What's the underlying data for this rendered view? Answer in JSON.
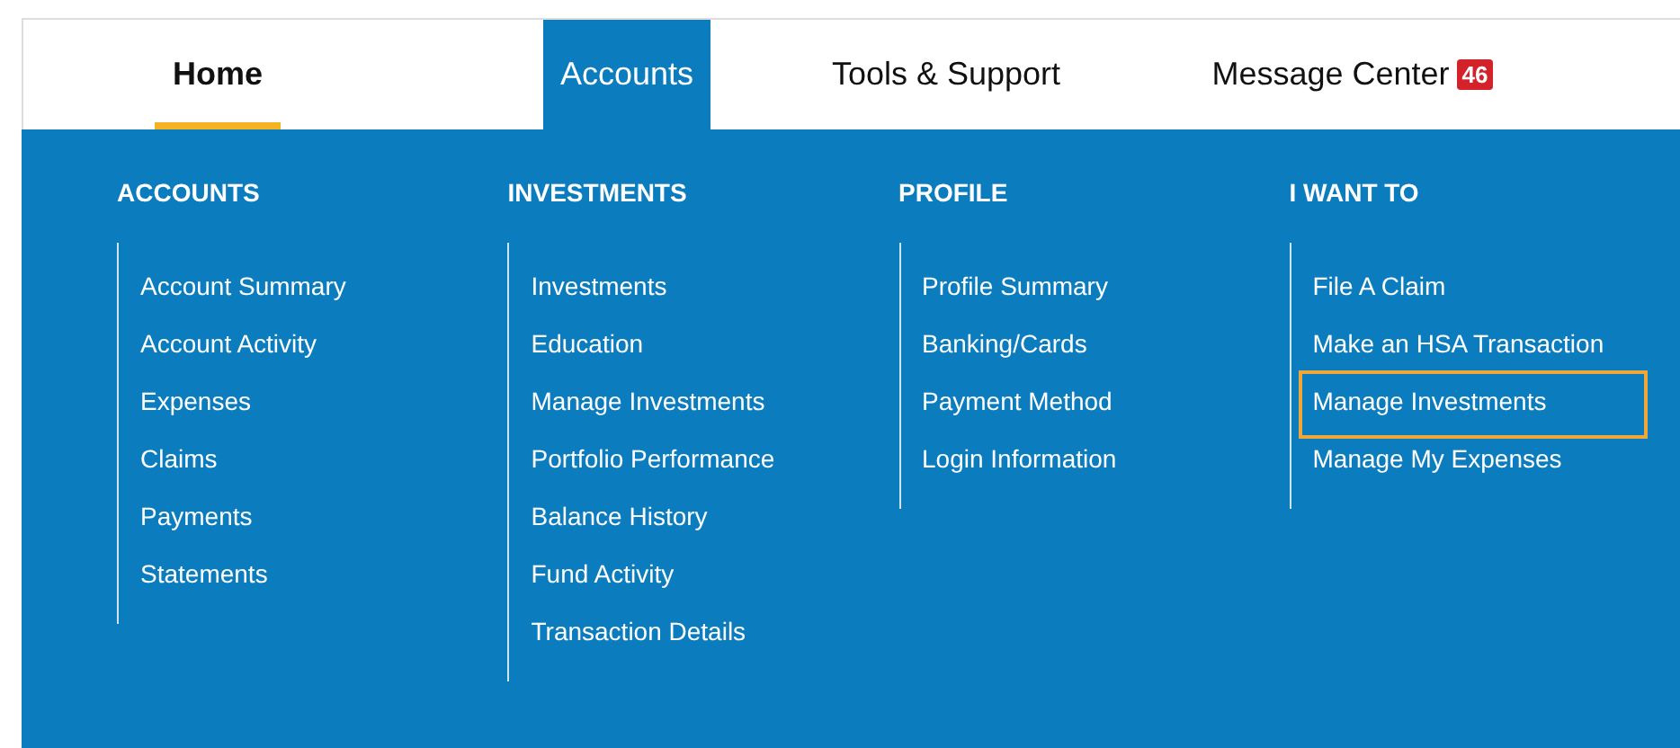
{
  "tabs": [
    {
      "label": "Home",
      "selected": false,
      "current": true
    },
    {
      "label": "Accounts",
      "selected": true,
      "current": false
    },
    {
      "label": "Tools & Support",
      "selected": false,
      "current": false
    },
    {
      "label": "Message Center",
      "selected": false,
      "current": false,
      "badge": "46"
    }
  ],
  "menu": [
    {
      "heading": "ACCOUNTS",
      "items": [
        {
          "label": "Account Summary",
          "highlighted": false
        },
        {
          "label": "Account Activity",
          "highlighted": false
        },
        {
          "label": "Expenses",
          "highlighted": false
        },
        {
          "label": "Claims",
          "highlighted": false
        },
        {
          "label": "Payments",
          "highlighted": false
        },
        {
          "label": "Statements",
          "highlighted": false
        }
      ]
    },
    {
      "heading": "INVESTMENTS",
      "items": [
        {
          "label": "Investments",
          "highlighted": false
        },
        {
          "label": "Education",
          "highlighted": false
        },
        {
          "label": "Manage Investments",
          "highlighted": false
        },
        {
          "label": "Portfolio Performance",
          "highlighted": false
        },
        {
          "label": "Balance History",
          "highlighted": false
        },
        {
          "label": "Fund Activity",
          "highlighted": false
        },
        {
          "label": "Transaction Details",
          "highlighted": false
        }
      ]
    },
    {
      "heading": "PROFILE",
      "items": [
        {
          "label": "Profile Summary",
          "highlighted": false
        },
        {
          "label": "Banking/Cards",
          "highlighted": false
        },
        {
          "label": "Payment Method",
          "highlighted": false
        },
        {
          "label": "Login Information",
          "highlighted": false
        }
      ]
    },
    {
      "heading": "I WANT TO",
      "items": [
        {
          "label": "File A Claim",
          "highlighted": false
        },
        {
          "label": "Make an HSA Transaction",
          "highlighted": false
        },
        {
          "label": "Manage Investments",
          "highlighted": true
        },
        {
          "label": "Manage My Expenses",
          "highlighted": false
        }
      ]
    }
  ]
}
